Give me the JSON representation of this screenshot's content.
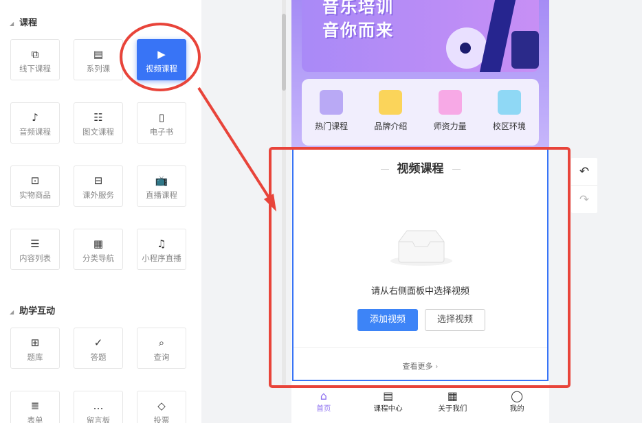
{
  "left_panel": {
    "sections": [
      {
        "title": "课程",
        "items": [
          {
            "label": "线下课程",
            "icon": "offline-course-icon"
          },
          {
            "label": "系列课",
            "icon": "folder-list-icon"
          },
          {
            "label": "视频课程",
            "icon": "video-icon",
            "active": true
          },
          {
            "label": "音频课程",
            "icon": "audio-icon"
          },
          {
            "label": "图文课程",
            "icon": "list-icon"
          },
          {
            "label": "电子书",
            "icon": "ebook-icon"
          },
          {
            "label": "实物商品",
            "icon": "box-icon"
          },
          {
            "label": "课外服务",
            "icon": "briefcase-icon"
          },
          {
            "label": "直播课程",
            "icon": "tv-icon"
          },
          {
            "label": "内容列表",
            "icon": "content-list-icon"
          },
          {
            "label": "分类导航",
            "icon": "grid-icon"
          },
          {
            "label": "小程序直播",
            "icon": "mini-live-icon"
          }
        ]
      },
      {
        "title": "助学互动",
        "items": [
          {
            "label": "题库",
            "icon": "question-bank-icon"
          },
          {
            "label": "答题",
            "icon": "answer-icon"
          },
          {
            "label": "查询",
            "icon": "query-icon"
          },
          {
            "label": "表单",
            "icon": "form-icon"
          },
          {
            "label": "留言板",
            "icon": "message-icon"
          },
          {
            "label": "投票",
            "icon": "vote-icon"
          }
        ]
      }
    ]
  },
  "phone": {
    "banner": {
      "line1": "音乐培训",
      "line2": "音你而来"
    },
    "nav": [
      {
        "label": "热门课程",
        "color": "#b9a9f5"
      },
      {
        "label": "品牌介绍",
        "color": "#fbd45a"
      },
      {
        "label": "师资力量",
        "color": "#f7a9e6"
      },
      {
        "label": "校区环境",
        "color": "#8fd8f5"
      }
    ],
    "module": {
      "title": "视频课程",
      "hint": "请从右侧面板中选择视频",
      "add_button": "添加视频",
      "select_button": "选择视频",
      "more": "查看更多"
    },
    "tabbar": [
      {
        "label": "首页",
        "icon": "home-icon",
        "active": true
      },
      {
        "label": "课程中心",
        "icon": "course-center-icon"
      },
      {
        "label": "关于我们",
        "icon": "about-icon"
      },
      {
        "label": "我的",
        "icon": "user-icon"
      }
    ]
  },
  "colors": {
    "accent": "#3874f6",
    "annotation": "#e8443a",
    "tab_active": "#8b6df0"
  }
}
